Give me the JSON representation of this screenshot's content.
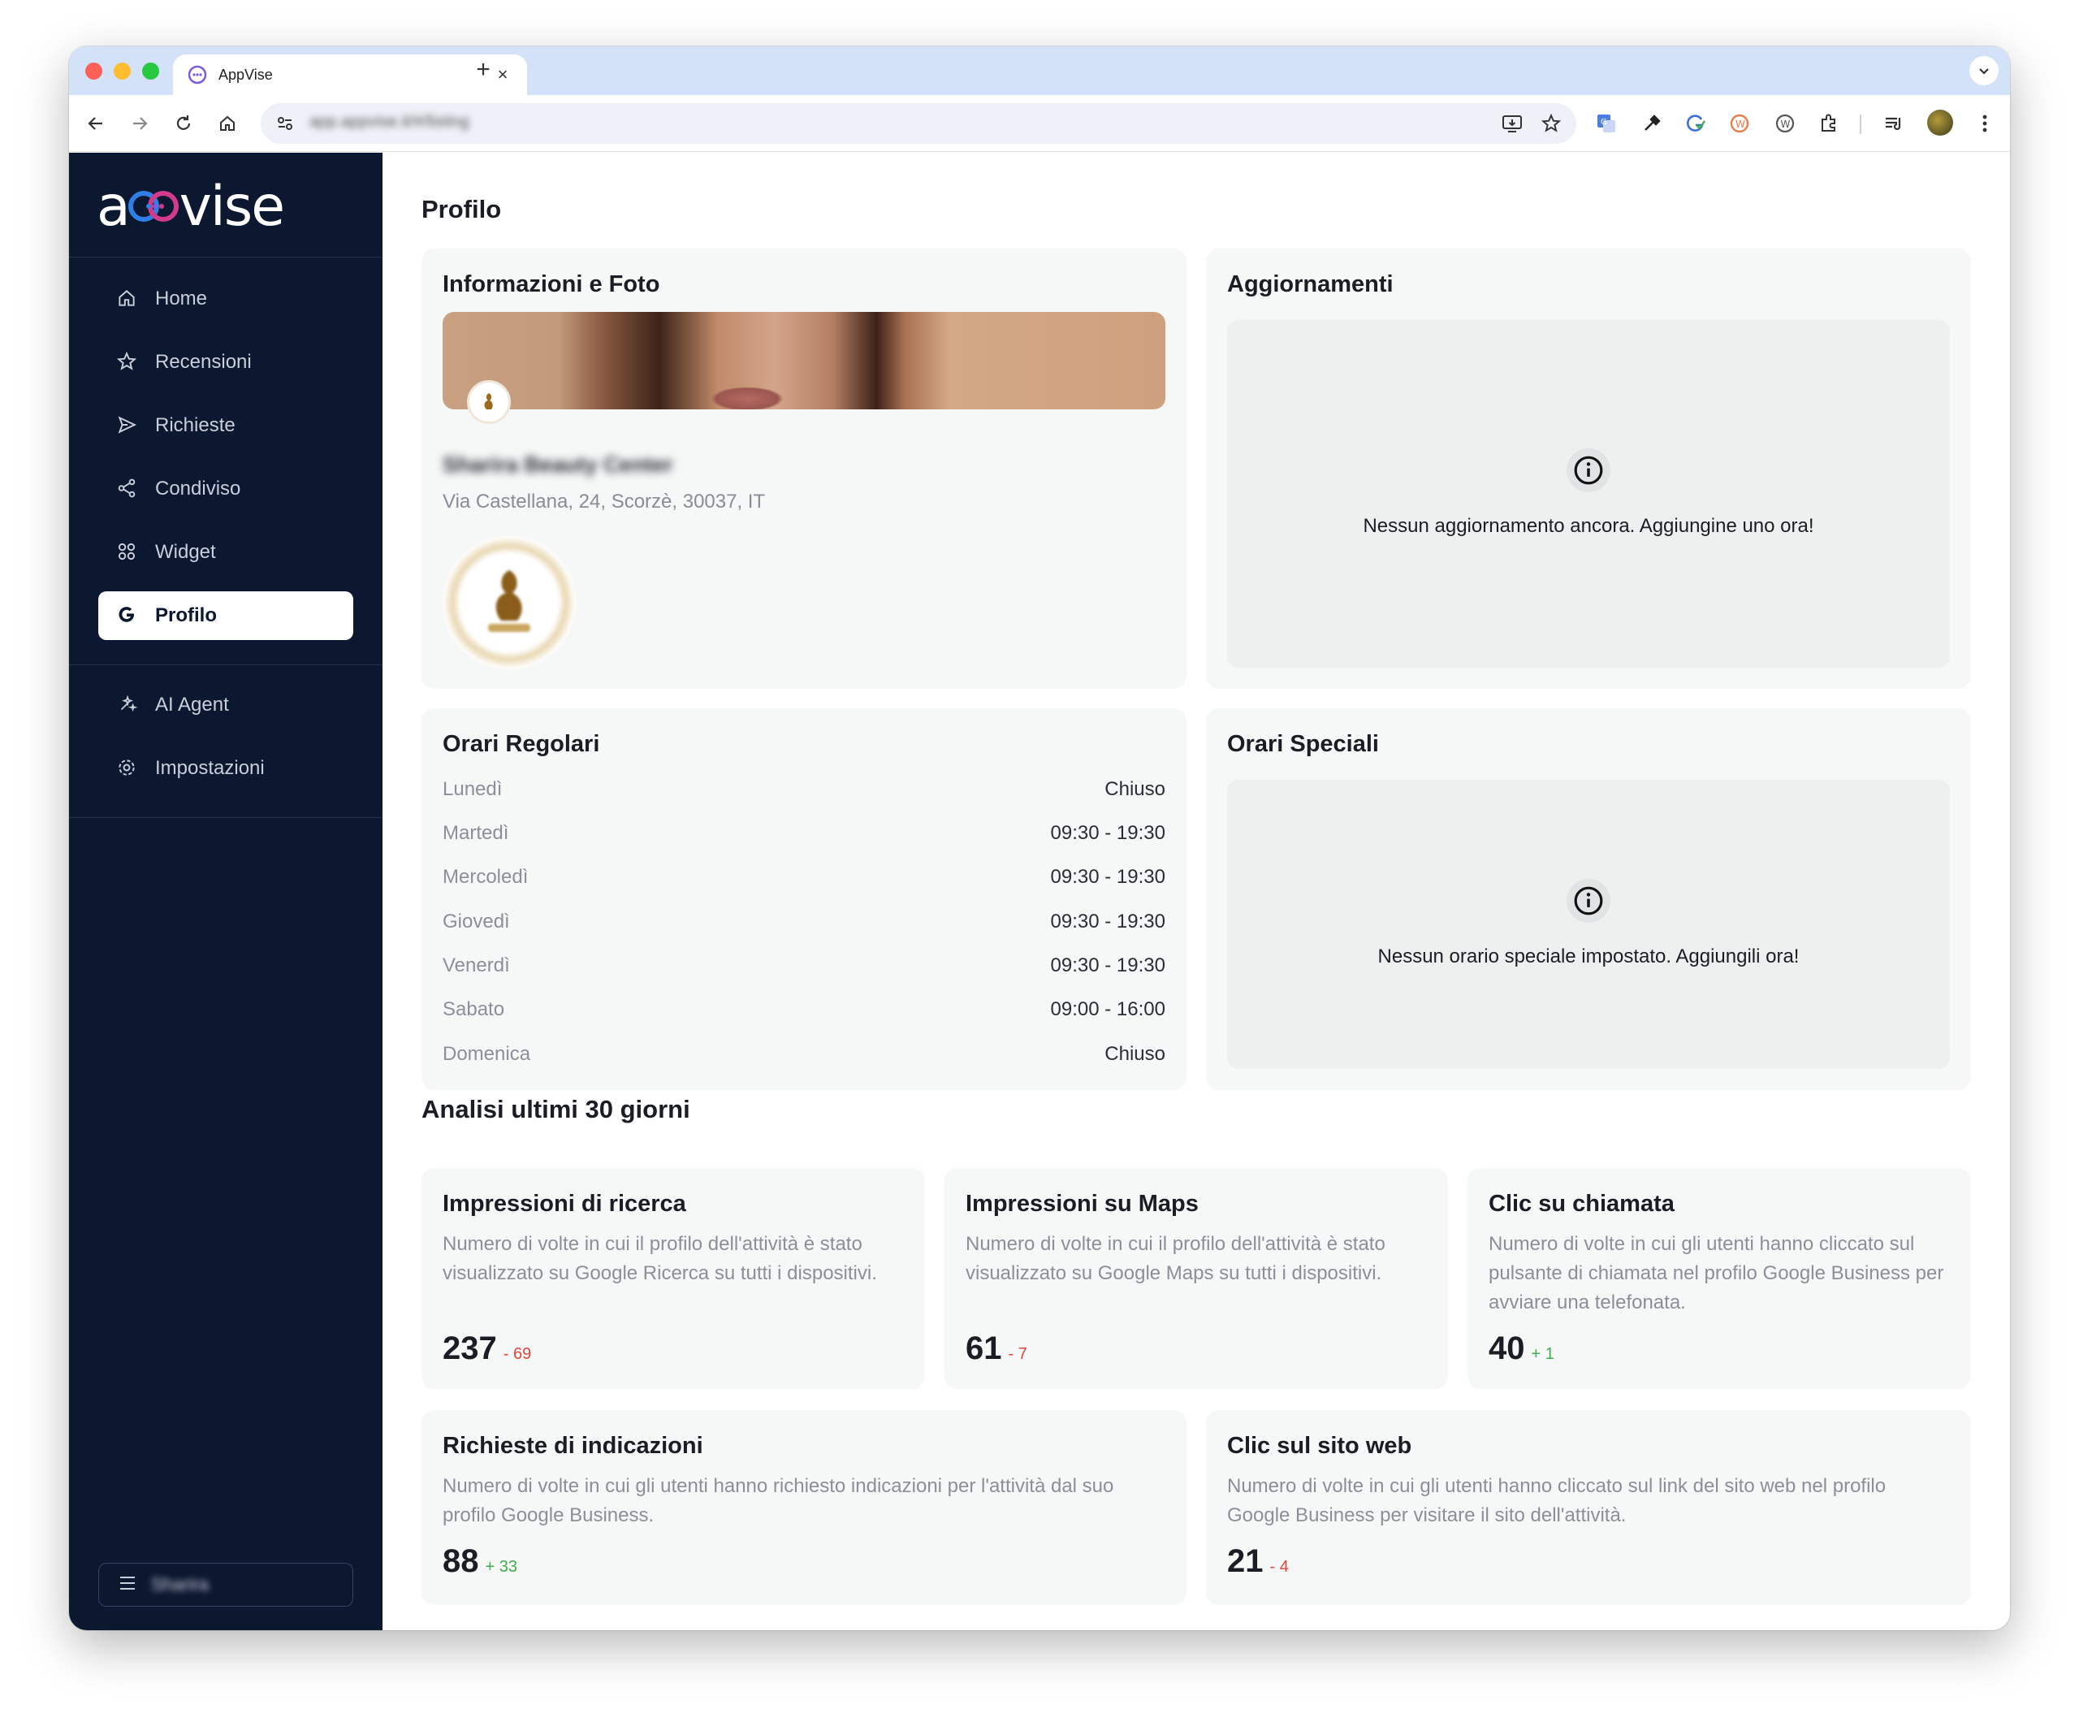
{
  "browser": {
    "tab_title": "AppVise",
    "tab_close": "×",
    "new_tab": "+",
    "url": "app.appvise.it/#/listing"
  },
  "sidebar": {
    "logo_left": "a",
    "logo_right": "vise",
    "items": [
      {
        "label": "Home",
        "icon": "home-icon"
      },
      {
        "label": "Recensioni",
        "icon": "star-icon"
      },
      {
        "label": "Richieste",
        "icon": "send-icon"
      },
      {
        "label": "Condiviso",
        "icon": "share-icon"
      },
      {
        "label": "Widget",
        "icon": "widget-icon"
      },
      {
        "label": "Profilo",
        "icon": "google-icon",
        "active": true
      },
      {
        "label": "AI Agent",
        "icon": "ai-sparkle-icon"
      },
      {
        "label": "Impostazioni",
        "icon": "gear-icon"
      }
    ],
    "user_name": "Sharira"
  },
  "main": {
    "page_title": "Profilo",
    "info_card": {
      "title": "Informazioni e Foto",
      "business_name": "Sharira Beauty Center",
      "address": "Via Castellana, 24, Scorzè, 30037, IT"
    },
    "updates_card": {
      "title": "Aggiornamenti",
      "empty_text": "Nessun aggiornamento ancora. Aggiungine uno ora!"
    },
    "regular_hours": {
      "title": "Orari Regolari",
      "rows": [
        {
          "day": "Lunedì",
          "time": "Chiuso"
        },
        {
          "day": "Martedì",
          "time": "09:30 - 19:30"
        },
        {
          "day": "Mercoledì",
          "time": "09:30 - 19:30"
        },
        {
          "day": "Giovedì",
          "time": "09:30 - 19:30"
        },
        {
          "day": "Venerdì",
          "time": "09:30 - 19:30"
        },
        {
          "day": "Sabato",
          "time": "09:00 - 16:00"
        },
        {
          "day": "Domenica",
          "time": "Chiuso"
        }
      ]
    },
    "special_hours": {
      "title": "Orari Speciali",
      "empty_text": "Nessun orario speciale impostato. Aggiungili ora!"
    },
    "analytics": {
      "title": "Analisi ultimi 30 giorni",
      "metrics": [
        {
          "title": "Impressioni di ricerca",
          "desc": "Numero di volte in cui il profilo dell'attività è stato visualizzato su Google Ricerca su tutti i dispositivi.",
          "value": "237",
          "delta": "- 69",
          "trend": "neg"
        },
        {
          "title": "Impressioni su Maps",
          "desc": "Numero di volte in cui il profilo dell'attività è stato visualizzato su Google Maps su tutti i dispositivi.",
          "value": "61",
          "delta": "- 7",
          "trend": "neg"
        },
        {
          "title": "Clic su chiamata",
          "desc": "Numero di volte in cui gli utenti hanno cliccato sul pulsante di chiamata nel profilo Google Business per avviare una telefonata.",
          "value": "40",
          "delta": "+ 1",
          "trend": "pos"
        },
        {
          "title": "Richieste di indicazioni",
          "desc": "Numero di volte in cui gli utenti hanno richiesto indicazioni per l'attività dal suo profilo Google Business.",
          "value": "88",
          "delta": "+ 33",
          "trend": "pos"
        },
        {
          "title": "Clic sul sito web",
          "desc": "Numero di volte in cui gli utenti hanno cliccato sul link del sito web nel profilo Google Business per visitare il sito dell'attività.",
          "value": "21",
          "delta": "- 4",
          "trend": "neg"
        }
      ]
    }
  },
  "colors": {
    "sidebar_bg": "#0c1730",
    "card_bg": "#f6f7f7",
    "negative": "#e2453a",
    "positive": "#3fae4e"
  }
}
